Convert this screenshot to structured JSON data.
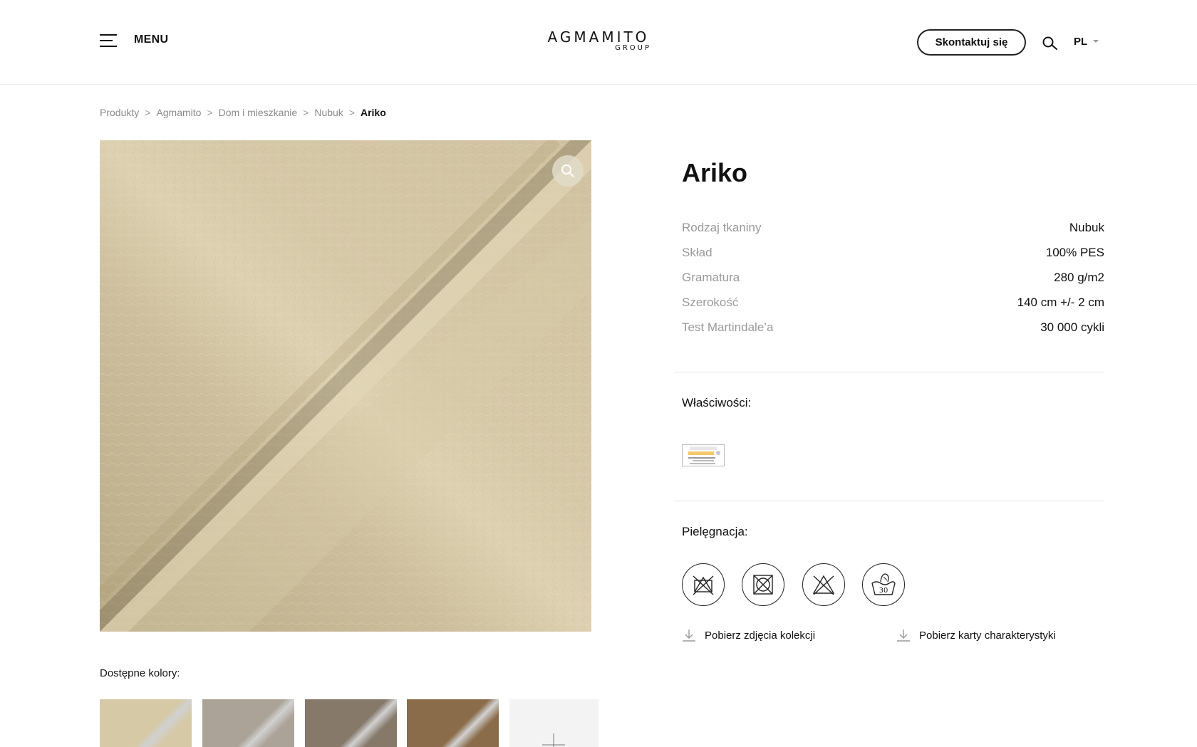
{
  "header": {
    "menu_label": "MENU",
    "logo_main": "AGMAMITO",
    "logo_sub": "GROUP",
    "contact_label": "Skontaktuj się",
    "language": "PL"
  },
  "breadcrumb": [
    "Produkty",
    "Agmamito",
    "Dom i mieszkanie",
    "Nubuk",
    "Ariko"
  ],
  "breadcrumb_separator": ">",
  "product": {
    "title": "Ariko",
    "specs": [
      {
        "label": "Rodzaj tkaniny",
        "value": "Nubuk"
      },
      {
        "label": "Skład",
        "value": "100% PES"
      },
      {
        "label": "Gramatura",
        "value": "280 g/m2"
      },
      {
        "label": "Szerokość",
        "value": "140 cm +/- 2 cm"
      },
      {
        "label": "Test Martindale’a",
        "value": "30 000 cykli"
      }
    ],
    "properties_label": "Właściwości:",
    "care_label": "Pielęgnacja:",
    "care_icons": [
      "no-bleach-icon",
      "no-tumble-dry-icon",
      "no-dry-clean-icon",
      "hand-wash-30-icon"
    ],
    "wash_temp": "30",
    "downloads": [
      "Pobierz zdjęcia kolekcji",
      "Pobierz karty charakterystyki"
    ]
  },
  "colors": {
    "label": "Dostępne kolory:",
    "swatches": [
      "#d6c9a6",
      "#aca398",
      "#86796a",
      "#8a6c4a"
    ]
  },
  "theme": {
    "fabric_base": "#d2c5a5",
    "accent": "#111111",
    "muted": "#9a9a9a"
  }
}
